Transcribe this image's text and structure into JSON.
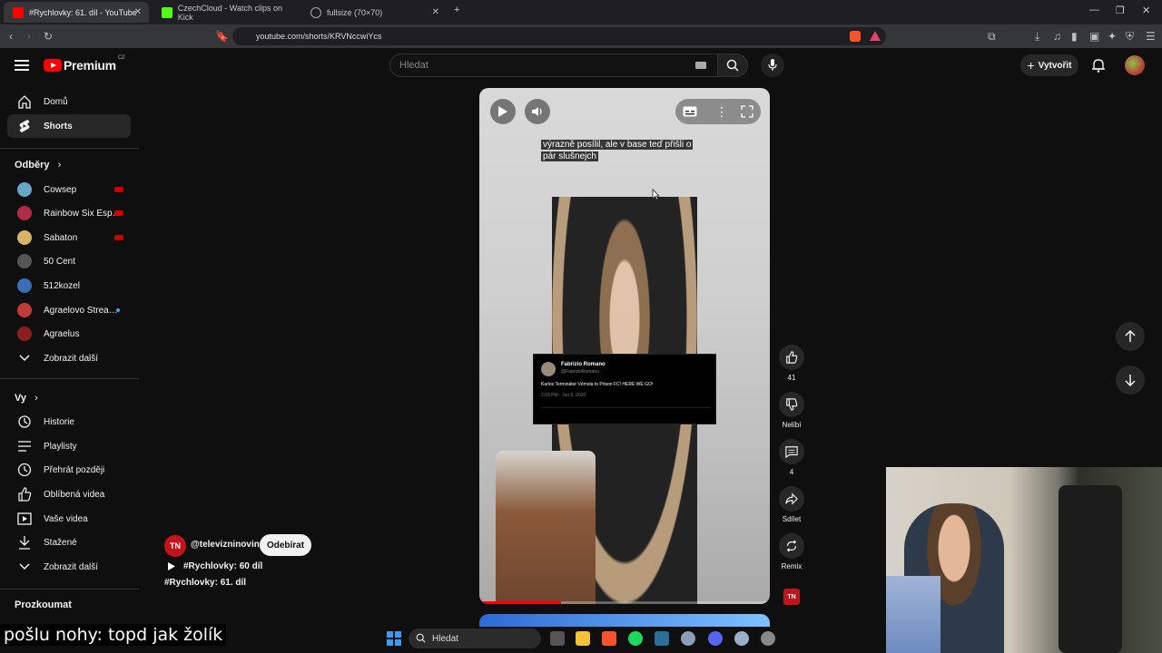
{
  "browser": {
    "tabs": [
      {
        "title": "#Rychlovky: 61. díl - YouTube",
        "active": true
      },
      {
        "title": "CzechCloud - Watch clips on Kick",
        "active": false
      },
      {
        "title": "fullsize (70×70)",
        "active": false
      }
    ],
    "url": "youtube.com/shorts/KRVNccwiYcs"
  },
  "youtube": {
    "logo_text": "Premium",
    "logo_region": "CZ",
    "search_placeholder": "Hledat",
    "create_label": "Vytvořit"
  },
  "sidebar": {
    "main": [
      {
        "label": "Domů",
        "icon": "home-icon"
      },
      {
        "label": "Shorts",
        "icon": "shorts-icon",
        "active": true
      }
    ],
    "subs_heading": "Odběry",
    "subs": [
      {
        "label": "Cowsep",
        "live": true,
        "color": "#6aa6c8"
      },
      {
        "label": "Rainbow Six Esp…",
        "live": true,
        "color": "#b02a4a"
      },
      {
        "label": "Sabaton",
        "live": true,
        "color": "#d9b36a"
      },
      {
        "label": "50 Cent",
        "live": false,
        "color": "#555555"
      },
      {
        "label": "512kozel",
        "live": false,
        "color": "#3a6fb5"
      },
      {
        "label": "Agraelovo Strea…",
        "live": false,
        "new": true,
        "color": "#c23b3b"
      },
      {
        "label": "Agraelus",
        "live": false,
        "color": "#8b1e1e"
      },
      {
        "label": "Zobrazit další",
        "icon": "chevron-down-icon"
      }
    ],
    "you_heading": "Vy",
    "you": [
      {
        "label": "Historie",
        "icon": "history-icon"
      },
      {
        "label": "Playlisty",
        "icon": "playlist-icon"
      },
      {
        "label": "Přehrát později",
        "icon": "clock-icon"
      },
      {
        "label": "Oblíbená videa",
        "icon": "thumbs-up-icon"
      },
      {
        "label": "Vaše videa",
        "icon": "video-icon"
      },
      {
        "label": "Stažené",
        "icon": "download-icon"
      },
      {
        "label": "Zobrazit další",
        "icon": "chevron-down-icon"
      }
    ],
    "explore_heading": "Prozkoumat"
  },
  "short": {
    "caption_line1": "výrazně posílil, ale v base teď přišli o",
    "caption_line2": "pár slušnejch",
    "tweet_author": "Fabrizio Romano",
    "tweet_handle": "@FabrizioRomano",
    "tweet_text": "Karlos Terminátor Vémola to Prison FC! HERE WE GO!",
    "tweet_meta": "2:03 PM · Jan 6, 2026",
    "progress": 0.28,
    "channel_avatar": "TN",
    "channel_name": "@televizninoviny",
    "subscribe_label": "Odebírat",
    "playlist_label": "#Rychlovky: 60 díl",
    "title": "#Rychlovky: 61. díl"
  },
  "actions": {
    "likes": "41",
    "dislike_label": "Nelíbí",
    "comments": "4",
    "share_label": "Sdílet",
    "remix_label": "Remix",
    "channel_badge": "TN"
  },
  "overlay": {
    "subtitle": "pošlu nohy: topd jak žolík"
  },
  "taskbar": {
    "search_label": "Hledat"
  }
}
